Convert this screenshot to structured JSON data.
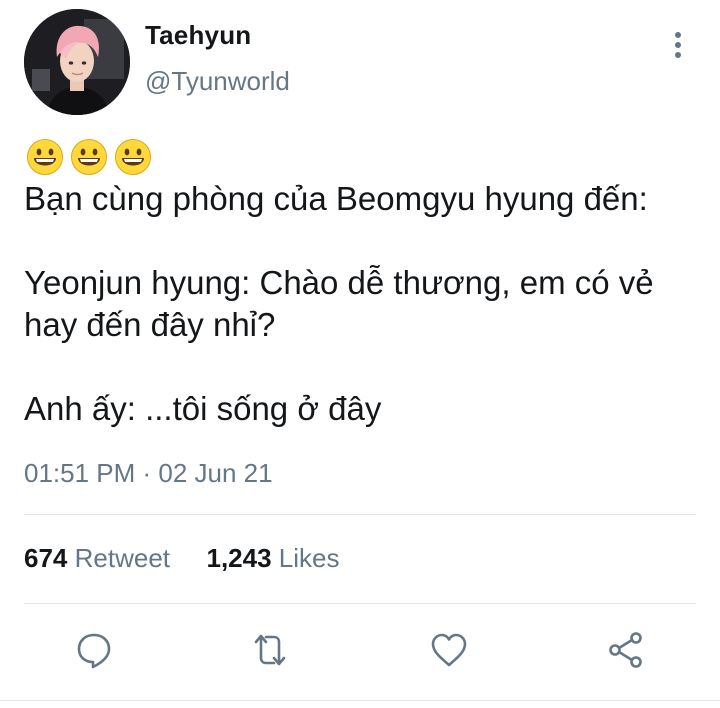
{
  "author": {
    "display_name": "Taehyun",
    "handle": "@Tyunworld"
  },
  "tweet": {
    "emojis": [
      "grinning-face",
      "grinning-face",
      "grinning-face"
    ],
    "lines": [
      "Bạn cùng phòng của Beomgyu hyung đến:",
      "",
      "Yeonjun hyung: Chào dễ thương, em có vẻ",
      "hay đến đây nhỉ?",
      "",
      "Anh ấy: ...tôi sống ở đây"
    ],
    "timestamp": "01:51 PM · 02 Jun 21"
  },
  "stats": {
    "retweet_count": "674",
    "retweet_label": "Retweet",
    "likes_count": "1,243",
    "likes_label": "Likes"
  },
  "actions": [
    "reply-icon",
    "retweet-icon",
    "like-icon",
    "share-icon"
  ],
  "colors": {
    "text": "#14171a",
    "secondary": "#657786",
    "icon": "#657786",
    "divider": "#e1e8ed"
  }
}
